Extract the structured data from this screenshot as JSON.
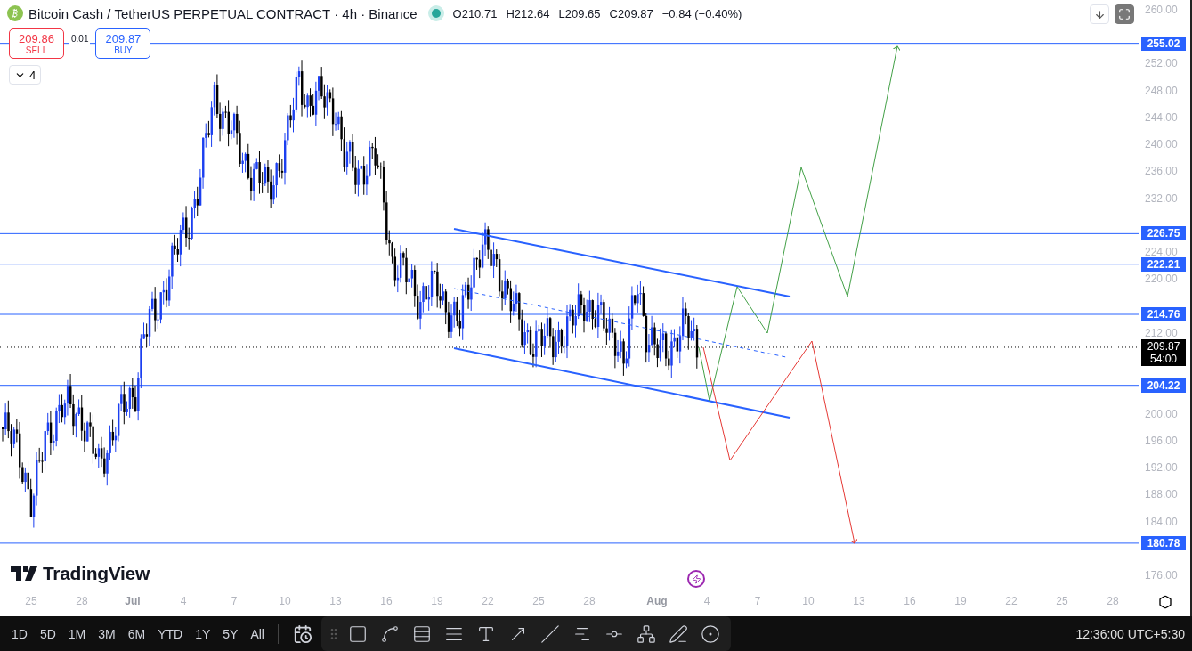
{
  "header": {
    "title": "Bitcoin Cash / TetherUS PERPETUAL CONTRACT · 4h · Binance",
    "market_open": true,
    "ohlc": [
      "O210.71",
      "H212.64",
      "L209.65",
      "C209.87"
    ],
    "change": "−0.84 (−0.40%)"
  },
  "trade": {
    "sell": {
      "price": "209.86",
      "label": "SELL"
    },
    "spread": "0.01",
    "buy": {
      "price": "209.87",
      "label": "BUY"
    }
  },
  "indicators": {
    "count": "4",
    "expanded": false
  },
  "logo": "TradingView",
  "price_axis": {
    "ticks": [
      "260.00",
      "252.00",
      "248.00",
      "244.00",
      "240.00",
      "236.00",
      "232.00",
      "224.00",
      "220.00",
      "212.00",
      "200.00",
      "196.00",
      "192.00",
      "188.00",
      "184.00",
      "176.00"
    ],
    "levels": [
      "255.02",
      "226.75",
      "222.21",
      "214.76",
      "204.22",
      "180.78"
    ],
    "current": {
      "price": "209.87",
      "countdown": "54:00"
    }
  },
  "time_axis": [
    "25",
    "28",
    "Jul",
    "4",
    "7",
    "10",
    "13",
    "16",
    "19",
    "22",
    "25",
    "28",
    "Aug",
    "4",
    "7",
    "10",
    "13",
    "16",
    "19",
    "22",
    "25",
    "28"
  ],
  "ranges": [
    "1D",
    "5D",
    "1M",
    "3M",
    "6M",
    "YTD",
    "1Y",
    "5Y",
    "All"
  ],
  "clock": "12:36:00 UTC+5:30"
}
